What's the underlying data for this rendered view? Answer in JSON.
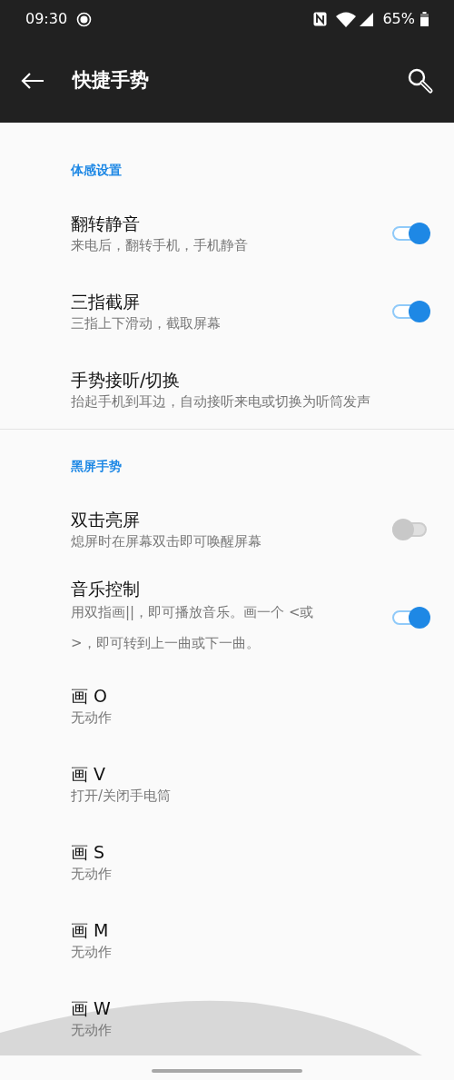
{
  "status_bar": {
    "time": "09:30",
    "battery": "65%"
  },
  "app_bar": {
    "title": "快捷手势"
  },
  "sections": [
    {
      "title": "体感设置",
      "items": [
        {
          "kind": "toggle",
          "title": "翻转静音",
          "subtitle": "来电后，翻转手机，手机静音",
          "on": true
        },
        {
          "kind": "toggle",
          "title": "三指截屏",
          "subtitle": "三指上下滑动，截取屏幕",
          "on": true
        },
        {
          "kind": "plain",
          "title": "手势接听/切换",
          "subtitle": "抬起手机到耳边，自动接听来电或切换为听筒发声"
        }
      ]
    },
    {
      "title": "黑屏手势",
      "items": [
        {
          "kind": "toggle",
          "title": "双击亮屏",
          "subtitle": "熄屏时在屏幕双击即可唤醒屏幕",
          "on": false
        },
        {
          "kind": "toggle",
          "title": "音乐控制",
          "subtitle": "用双指画||，即可播放音乐。画一个 <或 >，即可转到上一曲或下一曲。",
          "on": true
        },
        {
          "kind": "plain",
          "title": "画 O",
          "subtitle": "无动作"
        },
        {
          "kind": "plain",
          "title": "画 V",
          "subtitle": "打开/关闭手电筒"
        },
        {
          "kind": "plain",
          "title": "画 S",
          "subtitle": "无动作"
        },
        {
          "kind": "plain",
          "title": "画 M",
          "subtitle": "无动作"
        },
        {
          "kind": "plain",
          "title": "画 W",
          "subtitle": "无动作"
        }
      ]
    }
  ]
}
